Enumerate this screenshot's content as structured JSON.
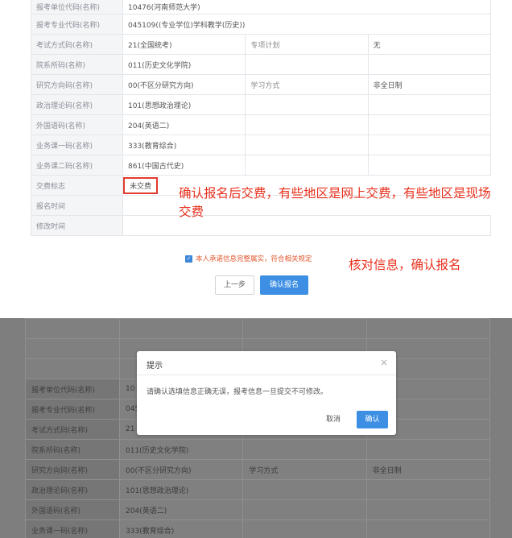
{
  "top_form": {
    "rows": [
      {
        "label": "报考单位代码(名称)",
        "value": "10476(河南师范大学)"
      },
      {
        "label": "报考专业代码(名称)",
        "value": "045109((专业学位)学科教学(历史))"
      },
      {
        "label": "考试方式码(名称)",
        "value": "21(全国统考)",
        "label2": "专项计划",
        "value2": "无"
      },
      {
        "label": "院系所码(名称)",
        "value": "011(历史文化学院)"
      },
      {
        "label": "研究方向码(名称)",
        "value": "00(不区分研究方向)",
        "label2": "学习方式",
        "value2": "非全日制"
      },
      {
        "label": "政治理论码(名称)",
        "value": "101(思想政治理论)"
      },
      {
        "label": "外国语码(名称)",
        "value": "204(英语二)"
      },
      {
        "label": "业务课一码(名称)",
        "value": "333(教育综合)"
      },
      {
        "label": "业务课二码(名称)",
        "value": "861(中国古代史)"
      },
      {
        "label": "交费标志",
        "value": "未交费"
      },
      {
        "label": "报名时间",
        "value": ""
      },
      {
        "label": "修改时间",
        "value": ""
      }
    ],
    "checkbox_label": "本人承诺信息完整属实，符合相关规定",
    "prev_button": "上一步",
    "submit_button": "确认报名"
  },
  "annotations": {
    "payment_note": "确认报名后交费，有些地区是网上交费，有些地区是现场交费",
    "confirm_note": "核对信息，确认报名"
  },
  "dialog": {
    "title": "提示",
    "close": "×",
    "message": "请确认选填信息正确无误，报考信息一旦提交不可修改。",
    "cancel": "取消",
    "ok": "确认"
  },
  "bottom_form": {
    "rows": [
      {
        "label": "报考单位代码(名称)",
        "value": "10"
      },
      {
        "label": "报考专业代码(名称)",
        "value": "045"
      },
      {
        "label": "考试方式码(名称)",
        "value": "21"
      },
      {
        "label": "院系所码(名称)",
        "value": "011(历史文化学院)"
      },
      {
        "label": "研究方向码(名称)",
        "value": "00(不区分研究方向)",
        "label2": "学习方式",
        "value2": "非全日制"
      },
      {
        "label": "政治理论码(名称)",
        "value": "101(思想政治理论)"
      },
      {
        "label": "外国语码(名称)",
        "value": "204(英语二)"
      },
      {
        "label": "业务课一码(名称)",
        "value": "333(教育综合)"
      }
    ]
  },
  "colors": {
    "accent": "#3c8fe3",
    "annotation": "#e8301c",
    "overlay": "#7e7e7e"
  }
}
